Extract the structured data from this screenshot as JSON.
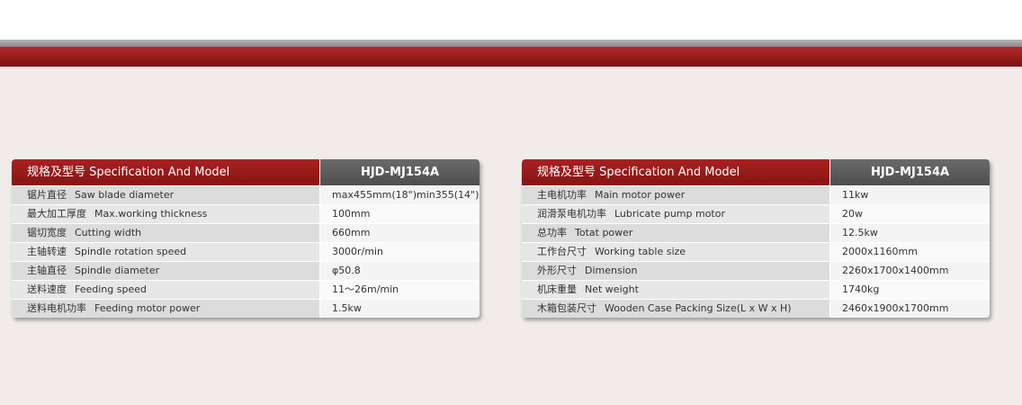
{
  "header_colors": {
    "red": "#9b1b1b",
    "grey": "#5b5b5b"
  },
  "tables": [
    {
      "header_spec": "规格及型号 Specification And Model",
      "header_model": "HJD-MJ154A",
      "rows": [
        {
          "cn": "锯片直径",
          "en": "Saw blade diameter",
          "value": "max455mm(18\")min355(14\")"
        },
        {
          "cn": "最大加工厚度",
          "en": "Max.working thickness",
          "value": "100mm"
        },
        {
          "cn": "锯切宽度",
          "en": "Cutting width",
          "value": "660mm"
        },
        {
          "cn": "主轴转速",
          "en": "Spindle rotation speed",
          "value": "3000r/min"
        },
        {
          "cn": "主轴直径",
          "en": "Spindle diameter",
          "value": "φ50.8"
        },
        {
          "cn": "送料速度",
          "en": "Feeding speed",
          "value": "11～26m/min"
        },
        {
          "cn": "送料电机功率",
          "en": "Feeding motor power",
          "value": "1.5kw"
        }
      ]
    },
    {
      "header_spec": "规格及型号 Specification And Model",
      "header_model": "HJD-MJ154A",
      "rows": [
        {
          "cn": "主电机功率",
          "en": "Main motor power",
          "value": "11kw"
        },
        {
          "cn": "润滑泵电机功率",
          "en": "Lubricate pump motor",
          "value": "20w"
        },
        {
          "cn": "总功率",
          "en": "Totat power",
          "value": "12.5kw"
        },
        {
          "cn": "工作台尺寸",
          "en": "Working table size",
          "value": "2000x1160mm"
        },
        {
          "cn": "外形尺寸",
          "en": "Dimension",
          "value": "2260x1700x1400mm"
        },
        {
          "cn": "机床重量",
          "en": "Net weight",
          "value": "1740kg"
        },
        {
          "cn": "木箱包装尺寸",
          "en": "Wooden Case Packing Size(L x W x H)",
          "value": "2460x1900x1700mm"
        }
      ]
    }
  ]
}
